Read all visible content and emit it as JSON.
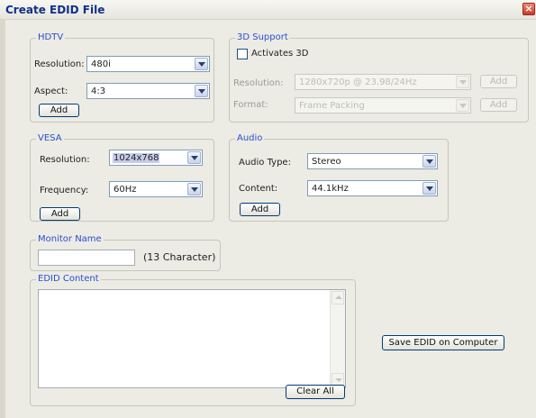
{
  "window": {
    "title": "Create EDID File",
    "close_glyph": "×"
  },
  "hdtv": {
    "legend": "HDTV",
    "resolution_label": "Resolution:",
    "resolution_value": "480i",
    "aspect_label": "Aspect:",
    "aspect_value": "4:3",
    "add_label": "Add"
  },
  "support3d": {
    "legend": "3D Support",
    "activates_label": "Activates 3D",
    "activates_checked": false,
    "resolution_label": "Resolution:",
    "resolution_value": "1280x720p @ 23.98/24Hz",
    "format_label": "Format:",
    "format_value": "Frame Packing",
    "add_label": "Add"
  },
  "vesa": {
    "legend": "VESA",
    "resolution_label": "Resolution:",
    "resolution_value": "1024x768",
    "frequency_label": "Frequency:",
    "frequency_value": "60Hz",
    "add_label": "Add"
  },
  "audio": {
    "legend": "Audio",
    "type_label": "Audio Type:",
    "type_value": "Stereo",
    "content_label": "Content:",
    "content_value": "44.1kHz",
    "add_label": "Add"
  },
  "monitor": {
    "legend": "Monitor Name",
    "value": "",
    "hint": "(13 Character)"
  },
  "edid": {
    "legend": "EDID Content",
    "content": "",
    "clear_label": "Clear All"
  },
  "actions": {
    "save_label": "Save EDID on Computer"
  },
  "icons": {
    "close": "close-icon",
    "dropdown": "chevron-down-icon",
    "scroll_up": "scroll-up-arrow-icon",
    "scroll_down": "scroll-down-arrow-icon"
  },
  "colors": {
    "title": "#10308a",
    "legend": "#2a4fd0",
    "window_bg": "#ecebe4",
    "close_button": "#c83c28"
  }
}
